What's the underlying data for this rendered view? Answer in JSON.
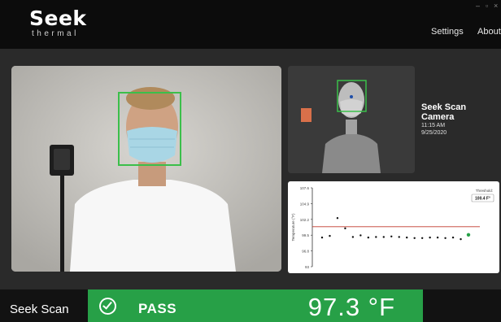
{
  "header": {
    "logo_main": "Seek",
    "logo_sub": "thermal",
    "nav": [
      "Settings",
      "About"
    ],
    "window_controls": [
      "–",
      "▫",
      "×"
    ]
  },
  "camera": {
    "name": "Seek Scan Camera",
    "time": "11:15 AM",
    "date": "9/25/2020"
  },
  "chart_data": {
    "type": "scatter",
    "ylabel": "Temperature (°F)",
    "y_ticks": [
      "107.6",
      "104.9",
      "102.2",
      "99.5",
      "96.8",
      "93"
    ],
    "threshold_label": "Threshold:",
    "threshold_value": "100.4 F°",
    "threshold": 100.4,
    "ylim": [
      93,
      107.6
    ],
    "points": [
      {
        "x": 1,
        "y": 98.4
      },
      {
        "x": 2,
        "y": 98.7
      },
      {
        "x": 3,
        "y": 102.0
      },
      {
        "x": 4,
        "y": 100.1
      },
      {
        "x": 5,
        "y": 98.5
      },
      {
        "x": 6,
        "y": 98.8
      },
      {
        "x": 7,
        "y": 98.4
      },
      {
        "x": 8,
        "y": 98.5
      },
      {
        "x": 9,
        "y": 98.5
      },
      {
        "x": 10,
        "y": 98.6
      },
      {
        "x": 11,
        "y": 98.5
      },
      {
        "x": 12,
        "y": 98.4
      },
      {
        "x": 13,
        "y": 98.3
      },
      {
        "x": 14,
        "y": 98.3
      },
      {
        "x": 15,
        "y": 98.4
      },
      {
        "x": 16,
        "y": 98.4
      },
      {
        "x": 17,
        "y": 98.3
      },
      {
        "x": 18,
        "y": 98.4
      },
      {
        "x": 19,
        "y": 98.1
      },
      {
        "x": 20,
        "y": 98.9
      }
    ],
    "last_point_color": "#27a047",
    "threshold_color": "#c0392b"
  },
  "footer": {
    "brand": "Seek Scan",
    "status": "PASS",
    "temperature": "97.3 °F",
    "status_color": "#27a047"
  }
}
